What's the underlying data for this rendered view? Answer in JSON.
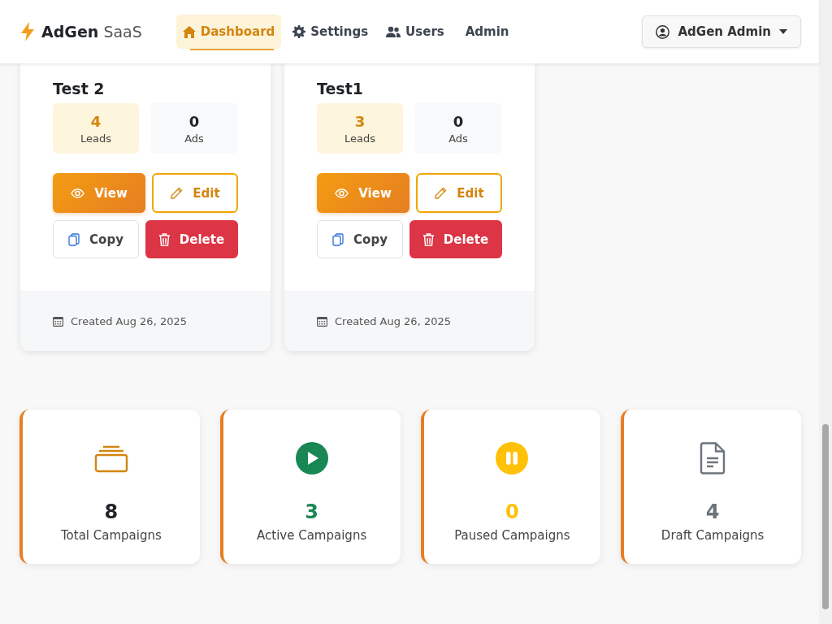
{
  "brand": {
    "name": "AdGen",
    "suffix": "SaaS"
  },
  "nav": [
    {
      "label": "Dashboard",
      "selected": true
    },
    {
      "label": "Settings",
      "selected": false
    },
    {
      "label": "Users",
      "selected": false
    },
    {
      "label": "Admin",
      "selected": false
    }
  ],
  "user_menu": {
    "label": "AdGen Admin"
  },
  "campaigns": [
    {
      "title": "Test 2",
      "leads": "4",
      "leads_label": "Leads",
      "ads": "0",
      "ads_label": "Ads",
      "buttons": [
        "View",
        "Edit",
        "Copy",
        "Delete"
      ],
      "created": "Created Aug 26, 2025"
    },
    {
      "title": "Test1",
      "leads": "3",
      "leads_label": "Leads",
      "ads": "0",
      "ads_label": "Ads",
      "buttons": [
        "View",
        "Edit",
        "Copy",
        "Delete"
      ],
      "created": "Created Aug 26, 2025"
    }
  ],
  "stats": [
    {
      "value": "8",
      "label": "Total Campaigns",
      "color": "#212529"
    },
    {
      "value": "3",
      "label": "Active Campaigns",
      "color": "#198754"
    },
    {
      "value": "0",
      "label": "Paused Campaigns",
      "color": "#ffc107"
    },
    {
      "value": "4",
      "label": "Draft Campaigns",
      "color": "#6c757d"
    }
  ]
}
